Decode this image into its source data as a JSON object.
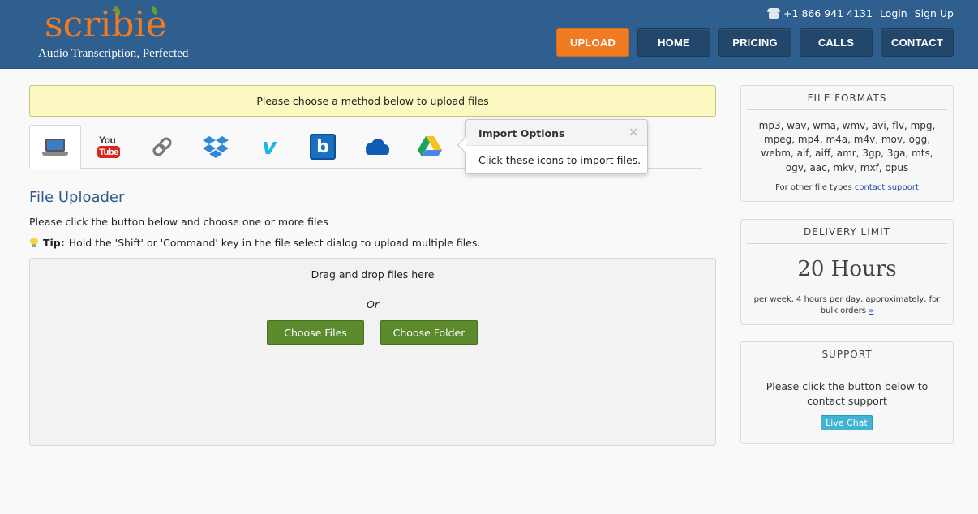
{
  "brand": {
    "logo_text": "scribie",
    "tagline": "Audio Transcription, Perfected",
    "logo_color": "#f07b22"
  },
  "header": {
    "phone": "+1 866 941 4131",
    "login": "Login",
    "signup": "Sign Up",
    "bg_color": "#2e5f8e",
    "nav": [
      {
        "label": "UPLOAD",
        "active": true
      },
      {
        "label": "HOME",
        "active": false
      },
      {
        "label": "PRICING",
        "active": false
      },
      {
        "label": "CALLS",
        "active": false
      },
      {
        "label": "CONTACT",
        "active": false
      }
    ]
  },
  "notice": "Please choose a method below to upload files",
  "import_tabs": [
    {
      "icon": "laptop-icon",
      "active": true
    },
    {
      "icon": "youtube-icon"
    },
    {
      "icon": "link-icon"
    },
    {
      "icon": "dropbox-icon"
    },
    {
      "icon": "vimeo-icon"
    },
    {
      "icon": "box-icon"
    },
    {
      "icon": "onedrive-icon"
    },
    {
      "icon": "google-drive-icon"
    }
  ],
  "youtube_icon": {
    "you": "You",
    "tube": "Tube"
  },
  "vimeo_icon": {
    "glyph": "v"
  },
  "box_icon": {
    "glyph": "b"
  },
  "popover": {
    "title": "Import Options",
    "close": "×",
    "body": "Click these icons to import files."
  },
  "uploader": {
    "title": "File Uploader",
    "instructions": "Please click the button below and choose one or more files",
    "tip_label": "Tip:",
    "tip_text": "Hold the 'Shift' or 'Command' key in the file select dialog to upload multiple files.",
    "drag_text": "Drag and drop files here",
    "or": "Or",
    "choose_files": "Choose Files",
    "choose_folder": "Choose Folder",
    "button_color": "#5b8b2d"
  },
  "sidebar": {
    "formats": {
      "title": "FILE FORMATS",
      "list": "mp3, wav, wma, wmv, avi, flv, mpg, mpeg, mp4, m4a, m4v, mov, ogg, webm, aif, aiff, amr, 3gp, 3ga, mts, ogv, aac, mkv, mxf, opus",
      "other_prefix": "For other file types",
      "other_link": "contact support"
    },
    "delivery": {
      "title": "DELIVERY LIMIT",
      "value": "20 Hours",
      "note": "per week, 4 hours per day, approximately, for bulk orders",
      "note_link": "»"
    },
    "support": {
      "title": "SUPPORT",
      "text": "Please click the button below to contact support",
      "button": "Live Chat",
      "button_color": "#41b3d3"
    }
  }
}
